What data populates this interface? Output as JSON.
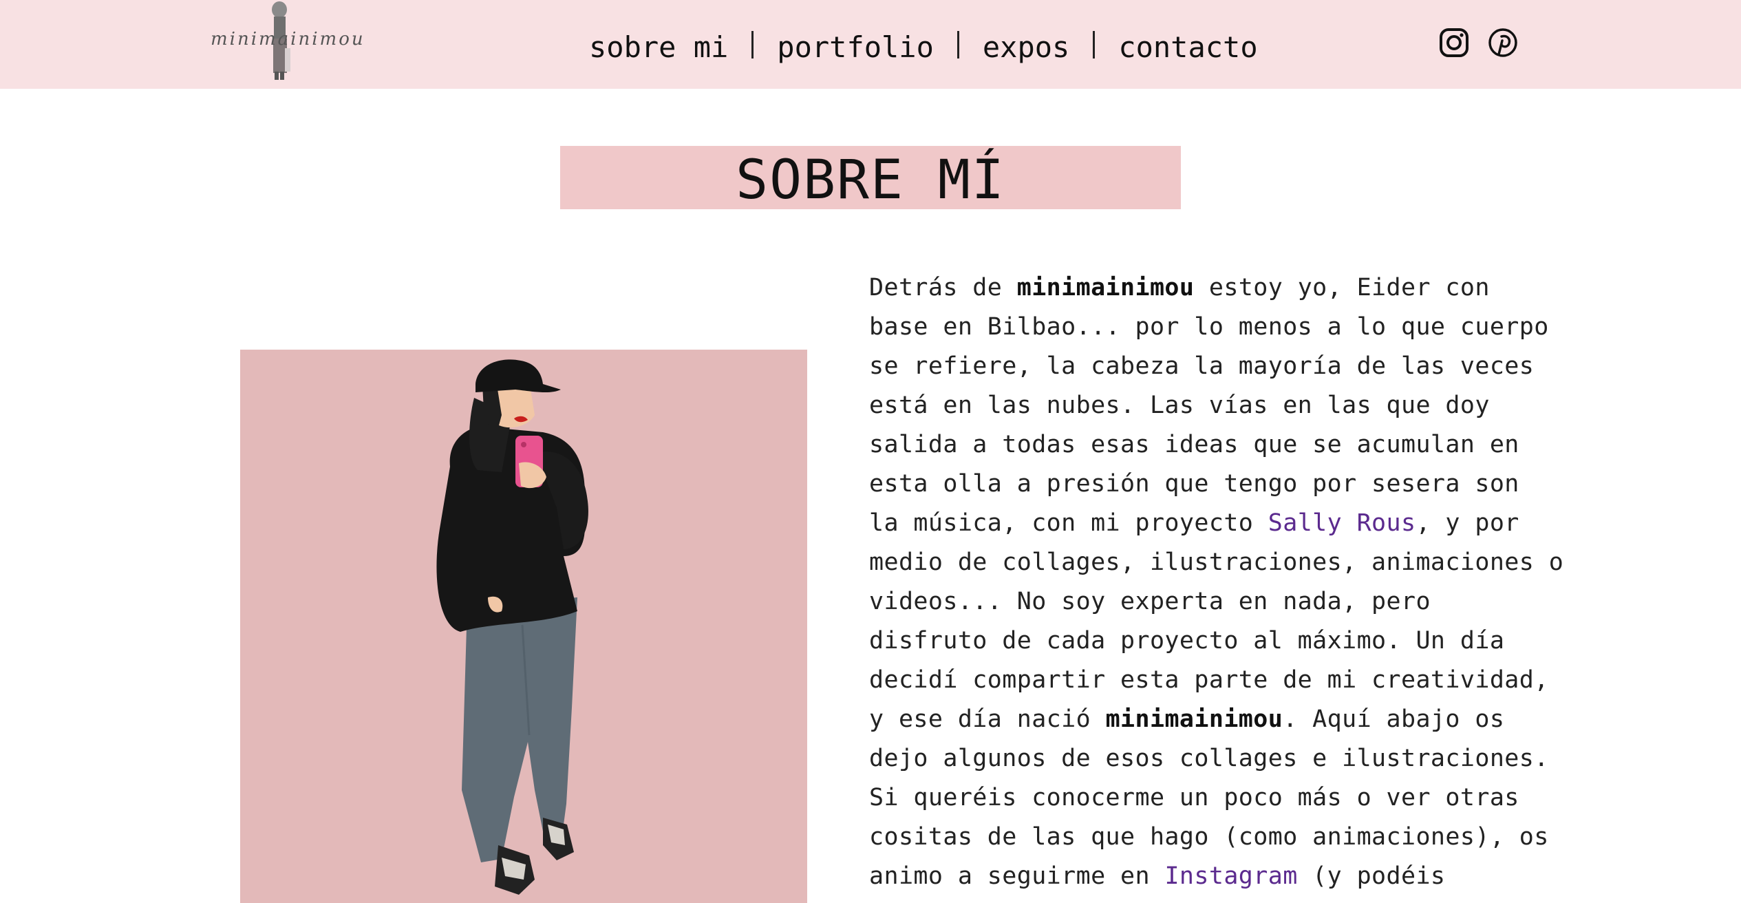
{
  "brand": {
    "logo_text": "minimainimou"
  },
  "nav": {
    "items": [
      "sobre mi",
      "portfolio",
      "expos",
      "contacto"
    ]
  },
  "social": {
    "instagram_icon": "instagram-icon",
    "pinterest_icon": "pinterest-icon"
  },
  "section": {
    "title": "SOBRE MÍ"
  },
  "bio": {
    "l1_a": "Detrás de ",
    "l1_b": "minimainimou",
    "l1_c": " estoy yo, Eider con",
    "l2": "base en Bilbao... por lo menos a lo que cuerpo",
    "l3": "se refiere, la cabeza la mayoría de las veces",
    "l4": "está en las nubes. Las vías en las que doy",
    "l5": "salida a todas esas ideas que se acumulan en",
    "l6": "esta olla a presión que tengo por sesera son",
    "l7_a": "la música, con mi proyecto ",
    "l7_link": "Sally Rous",
    "l7_c": ", y por",
    "l8": "medio de collages, ilustraciones, animaciones o",
    "l9": "videos... No soy experta en nada, pero",
    "l10": "disfruto de cada proyecto al máximo. Un día",
    "l11": "decidí compartir esta parte de mi creatividad,",
    "l12_a": "y ese día nació ",
    "l12_b": "minimainimou",
    "l12_c": ". Aquí abajo os",
    "l13": "dejo algunos de esos collages e ilustraciones.",
    "l14": "Si queréis conocerme un poco más o ver otras",
    "l15": "cositas de las que hago (como animaciones), os",
    "l16_a": "animo a seguirme en ",
    "l16_link": "Instagram",
    "l16_c": " (y podéis"
  },
  "colors": {
    "header_bg": "#f8e1e3",
    "title_bg": "#f0c8c9",
    "illustration_bg": "#e3b9b9",
    "link": "#5b2a8e"
  }
}
